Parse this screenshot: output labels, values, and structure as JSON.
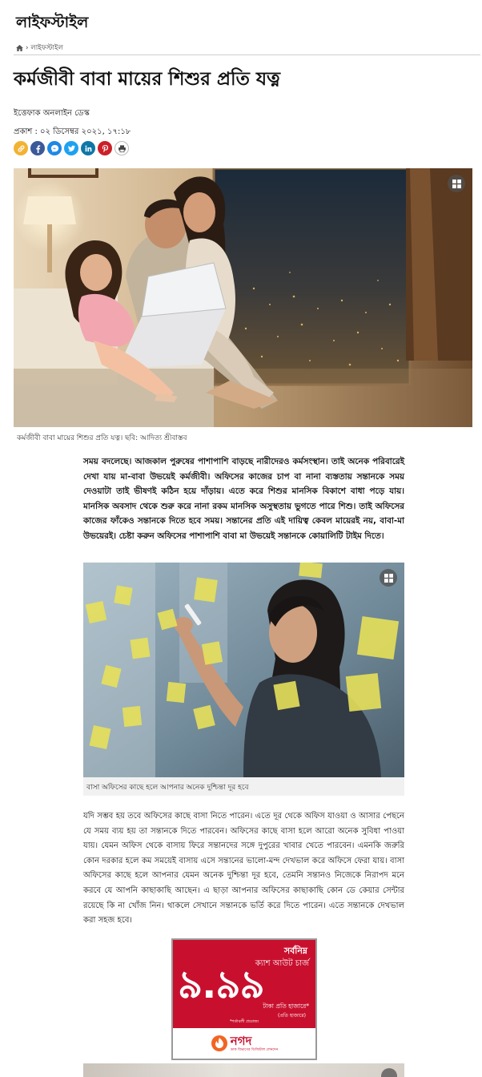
{
  "section": {
    "title": "লাইফস্টাইল"
  },
  "breadcrumb": {
    "home_icon": "home-icon",
    "separator": "›",
    "current": "লাইফস্টাইল"
  },
  "article": {
    "headline": "কর্মজীবী বাবা মায়ের শিশুর প্রতি যত্ন",
    "author": "ইত্তেফাক অনলাইন ডেস্ক",
    "published": "প্রকাশ : ০২ ডিসেম্বর ২০২১, ১৭:১৮",
    "share_icons": [
      "link-icon",
      "facebook-icon",
      "messenger-icon",
      "twitter-icon",
      "linkedin-icon",
      "pinterest-icon",
      "print-icon"
    ],
    "main_image_caption": "কর্মজীবী বাবা মায়ের শিশুর প্রতি যত্ন। ছবি: আদিত্য শ্রীবাস্তব",
    "lead": "সময় বদলেছে। আজকাল পুরুষের পাশাপাশি বাড়ছে নারীদেরও কর্মসংস্থান। তাই অনেক পরিবারেই দেখা যায় মা-বাবা উভয়েই কর্মজীবী। অফিসের কাজের চাপ বা নানা ব্যস্ততায় সন্তানকে সময় দেওয়াটা তাই ভীষণই কঠিন হয়ে দাঁড়ায়। এতে করে শিশুর মানসিক বিকাশে বাধা পড়ে যায়। মানসিক অবসাদ থেকে শুরু করে নানা রকম মানসিক অসুস্থতায় ভুগতে পারে শিশু। তাই অফিসের কাজের ফাঁকেও সন্তানকে দিতে হবে সময়। সন্তানের প্রতি এই দায়িত্ব কেবল মায়েরই নয়, বাবা-মা উভয়েরই। চেষ্টা করুন অফিসের পাশাপাশি বাবা মা উভয়েই সন্তানকে কোয়ালিটি টাইম দিতে।",
    "second_image_caption": "বাসা অফিসের কাছে হলে আপনার অনেক দুশ্চিন্তা দূর হবে",
    "paragraph": "যদি সম্ভব হয় তবে অফিসের কাছে বাসা নিতে পারেন। এতে দূর থেকে অফিস যাওয়া ও আসার পেছনে যে সময় ব্যয় হয় তা সন্তানকে দিতে পারবেন। অফিসের কাছে বাসা হলে আরো অনেক সুবিধা পাওয়া যায়। যেমন অফিস থেকে বাসায় ফিরে সন্তানদের সঙ্গে দুপুরের খাবার খেতে পারবেন। এমনকি জরুরি কোন দরকার হলে কম সময়েই বাসায় এসে সন্তানের ভালো-মন্দ দেখভাল করে অফিসে ফেরা যায়। বাসা অফিসের কাছে হলে আপনার যেমন অনেক দুশ্চিন্তা দূর হবে, তেমনি সন্তানও নিজেকে নিরাপদ মনে করবে যে আপনি কাছাকাছি আছেন। এ ছাড়া আপনার অফিসের কাছাকাছি কোন ডে কেয়ার সেন্টার রয়েছে কি না খোঁজ নিন। থাকলে সেখানে সন্তানকে ভর্তি করে দিতে পারেন। এতে সন্তানকে দেখভাল করা সহজ হবে।"
  },
  "ad": {
    "headline": "সর্বনিম্ন",
    "subhead": "ক্যাশ আউট চার্জ",
    "amount": "৯.৯৯",
    "unit": "টাকা প্রতি হাজারে*",
    "unit_note": "(প্রতি হাজারে)",
    "fineprint": "*শর্তাবলী প্রযোজ্য",
    "brand": "নগদ",
    "brand_tagline": "ডাক বিভাগের ডিজিটাল লেনদেন",
    "colors": {
      "red": "#c8102e",
      "orange": "#f26522"
    }
  },
  "colors": {
    "link": "#f2b233",
    "facebook": "#3b5998",
    "messenger": "#1e88e5",
    "twitter": "#1da1f2",
    "linkedin": "#0e76a8",
    "pinterest": "#cb2027",
    "print": "#555555"
  }
}
